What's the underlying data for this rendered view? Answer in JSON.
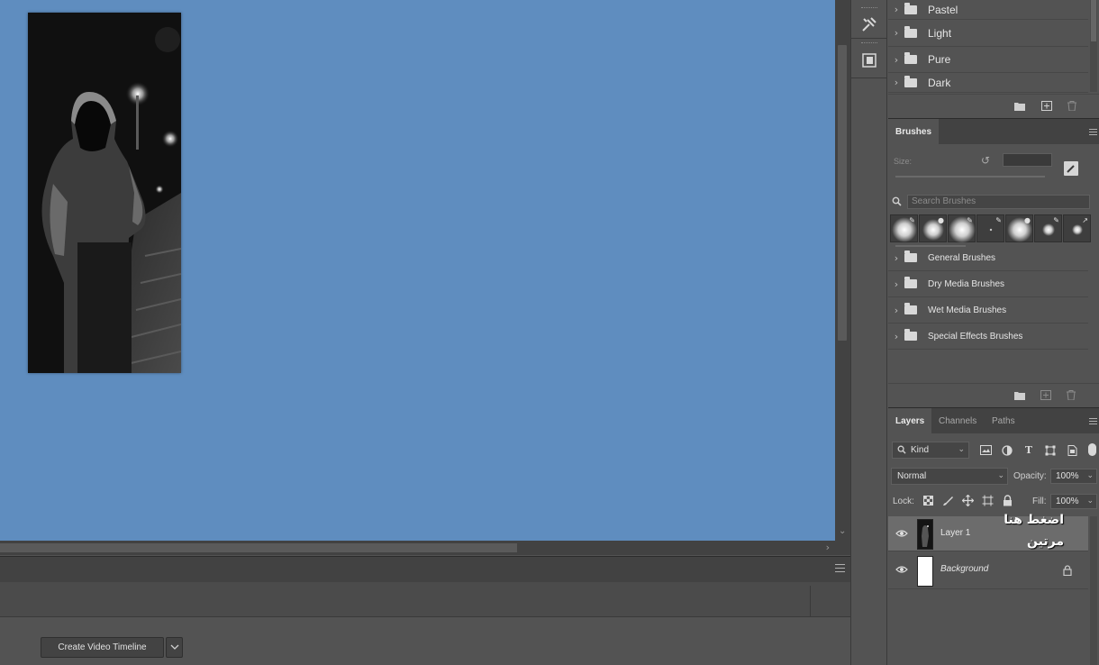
{
  "swatches": {
    "folders": [
      "Pastel",
      "Light",
      "Pure",
      "Dark"
    ]
  },
  "brushes": {
    "tab_label": "Brushes",
    "size_label": "Size:",
    "search_placeholder": "Search Brushes",
    "folders": [
      "General Brushes",
      "Dry Media Brushes",
      "Wet Media Brushes",
      "Special Effects Brushes"
    ]
  },
  "layers_panel": {
    "tabs": [
      "Layers",
      "Channels",
      "Paths"
    ],
    "filter_kind": "Kind",
    "blend_mode": "Normal",
    "opacity_label": "Opacity:",
    "opacity_value": "100%",
    "lock_label": "Lock:",
    "fill_label": "Fill:",
    "fill_value": "100%",
    "layers": [
      {
        "name": "Layer 1",
        "selected": true
      },
      {
        "name": "Background",
        "locked": true
      }
    ],
    "overlay_line1": "اضغط هنا",
    "overlay_line2": "مرتين"
  },
  "timeline": {
    "create_button": "Create Video Timeline"
  },
  "colors": {
    "canvas_bg": "#5f8dbf",
    "panel_bg": "#535353",
    "panel_dark": "#424242"
  }
}
